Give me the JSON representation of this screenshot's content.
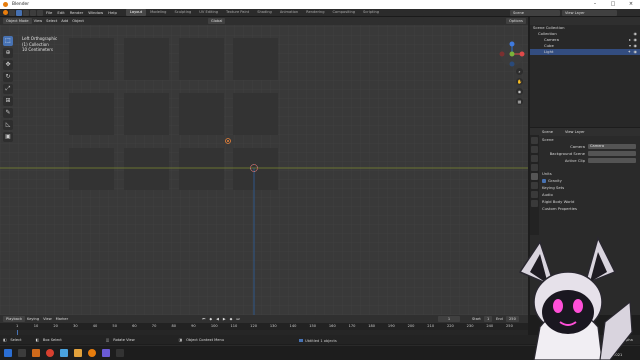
{
  "window": {
    "title": "Blender"
  },
  "menu": [
    "File",
    "Edit",
    "Render",
    "Window",
    "Help"
  ],
  "workspace_tabs": [
    "Layout",
    "Modeling",
    "Sculpting",
    "UV Editing",
    "Texture Paint",
    "Shading",
    "Animation",
    "Rendering",
    "Compositing",
    "Scripting"
  ],
  "active_tab_index": 0,
  "scene": {
    "name": "Scene",
    "view_layer": "View Layer"
  },
  "viewport_header": {
    "mode": "Object Mode",
    "menus": [
      "View",
      "Select",
      "Add",
      "Object"
    ],
    "orientation": "Global",
    "options": "Options"
  },
  "viewport_overlay": [
    "Left Orthographic",
    "(1) Collection",
    "10 Centimeters"
  ],
  "outliner": {
    "root": "Scene Collection",
    "items": [
      {
        "label": "Collection",
        "selected": false
      },
      {
        "label": "Camera",
        "selected": false
      },
      {
        "label": "Cube",
        "selected": false
      },
      {
        "label": "Light",
        "selected": true
      }
    ]
  },
  "properties": {
    "header": {
      "scene": "Scene",
      "view_layer": "View Layer"
    },
    "panel_title": "Scene",
    "fields": [
      {
        "label": "Camera",
        "value": "Camera"
      },
      {
        "label": "Background Scene",
        "value": ""
      },
      {
        "label": "Active Clip",
        "value": ""
      }
    ],
    "sections": [
      "Units",
      "Gravity",
      "Keying Sets",
      "Audio",
      "Rigid Body World",
      "Custom Properties"
    ],
    "gravity_checked": true
  },
  "timeline": {
    "menus": [
      "Playback",
      "Keying",
      "View",
      "Marker"
    ],
    "current_frame": "1",
    "start_label": "Start",
    "start": "1",
    "end_label": "End",
    "end": "250",
    "ticks": [
      "1",
      "10",
      "20",
      "30",
      "40",
      "50",
      "60",
      "70",
      "80",
      "90",
      "100",
      "110",
      "120",
      "130",
      "140",
      "150",
      "160",
      "170",
      "180",
      "190",
      "200",
      "210",
      "220",
      "230",
      "240",
      "250"
    ]
  },
  "status_bar": {
    "select": "Select",
    "box_select": "Box Select",
    "rotate_view": "Rotate View",
    "context_menu": "Object Context Menu",
    "version": "2.92.0 Alpha"
  },
  "taskbar": {
    "obs_label": "Ubtitled 1 objects",
    "time": "18:34",
    "date": "6.04.2021"
  },
  "colors": {
    "accent": "#4772b3",
    "viewport_bg": "#393939",
    "x_axis": "#8a9a2a",
    "z_axis": "#2f5f9e",
    "blender_orange": "#e87d0d"
  }
}
